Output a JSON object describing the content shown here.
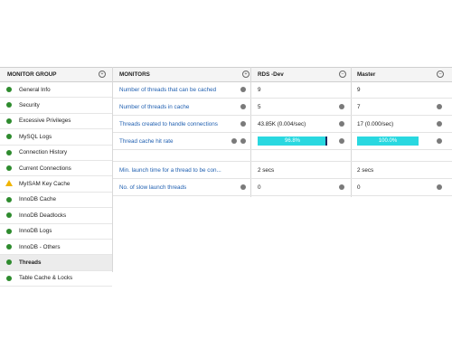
{
  "left_panel": {
    "title": "MONITOR GROUP",
    "items": [
      {
        "label": "General Info",
        "status": "green"
      },
      {
        "label": "Security",
        "status": "green"
      },
      {
        "label": "Excessive Privileges",
        "status": "green"
      },
      {
        "label": "MySQL Logs",
        "status": "green"
      },
      {
        "label": "Connection History",
        "status": "green"
      },
      {
        "label": "Current Connections",
        "status": "green"
      },
      {
        "label": "MyISAM Key Cache",
        "status": "warning"
      },
      {
        "label": "InnoDB Cache",
        "status": "green"
      },
      {
        "label": "InnoDB Deadlocks",
        "status": "green"
      },
      {
        "label": "InnoDB Logs",
        "status": "green"
      },
      {
        "label": "InnoDB - Others",
        "status": "green"
      },
      {
        "label": "Threads",
        "status": "green",
        "selected": true
      },
      {
        "label": "Table Cache & Locks",
        "status": "green"
      }
    ]
  },
  "table": {
    "headers": {
      "monitors": "MONITORS",
      "server1": "RDS -Dev",
      "server2": "Master"
    },
    "rows": [
      {
        "name": "Number of threads that can be cached",
        "v1": "9",
        "v2": "9"
      },
      {
        "name": "Number of threads in cache",
        "v1": "5",
        "v2": "7"
      },
      {
        "name": "Threads created to handle connections",
        "v1": "43.85K (0.004/sec)",
        "v2": "17 (0.000/sec)"
      },
      {
        "name": "Thread cache hit rate",
        "v1": "96.8%",
        "v2": "100.0%",
        "bar1": 0.968,
        "bar2": 1.0
      },
      {
        "name": "Min. launch time for a thread to be con...",
        "v1": "2 secs",
        "v2": "2 secs"
      },
      {
        "name": "No. of slow launch threads",
        "v1": "0",
        "v2": "0"
      }
    ]
  },
  "colors": {
    "status_green": "#2e8b2e",
    "warning": "#f0b400",
    "link": "#1f5fb0",
    "bar": "#29d8e0"
  },
  "icons": {
    "header_add": "plus-circle-icon",
    "row_info": "info-icon",
    "row_chart": "chart-icon"
  }
}
